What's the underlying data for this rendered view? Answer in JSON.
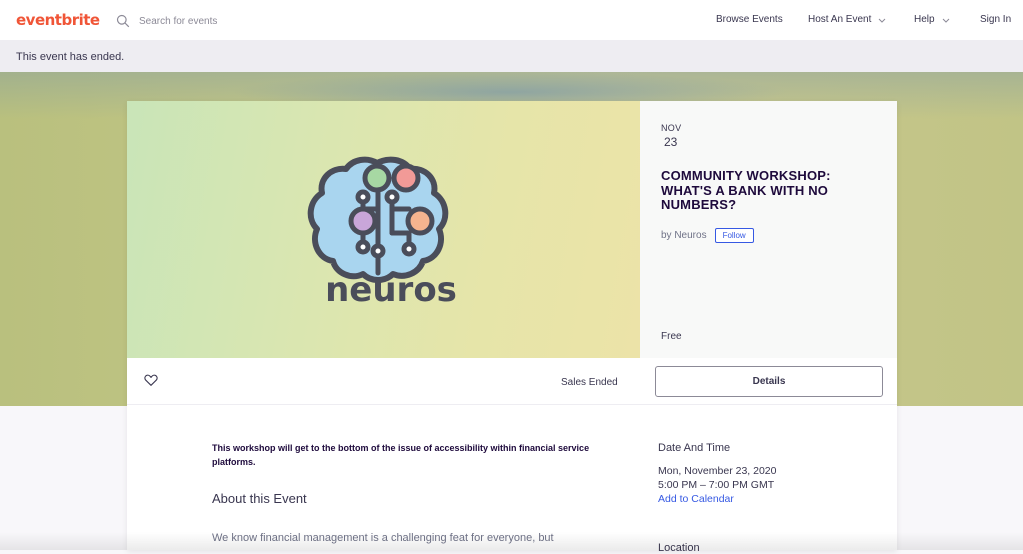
{
  "header": {
    "logo": "eventbrite",
    "search_placeholder": "Search for events",
    "nav": {
      "browse": "Browse Events",
      "host": "Host An Event",
      "help": "Help",
      "signin": "Sign In"
    }
  },
  "banner": {
    "text": "This event has ended."
  },
  "event": {
    "month": "NOV",
    "day": "23",
    "title": "COMMUNITY WORKSHOP: WHAT'S A BANK WITH NO NUMBERS?",
    "by_label": "by Neuros",
    "follow_label": "Follow",
    "price": "Free",
    "logo_text": "neuros"
  },
  "actions": {
    "sales_status": "Sales Ended",
    "details_label": "Details"
  },
  "body": {
    "summary": "This workshop will get to the bottom of the issue of accessibility within financial service platforms.",
    "about_heading": "About this Event",
    "description": "We know financial management is a challenging feat for everyone, but"
  },
  "sidebar": {
    "date_heading": "Date And Time",
    "date": "Mon, November 23, 2020",
    "time": "5:00 PM – 7:00 PM GMT",
    "calendar_link": "Add to Calendar",
    "location_heading": "Location"
  },
  "colors": {
    "brand": "#f05537",
    "link": "#3659e3",
    "text": "#39364f"
  }
}
